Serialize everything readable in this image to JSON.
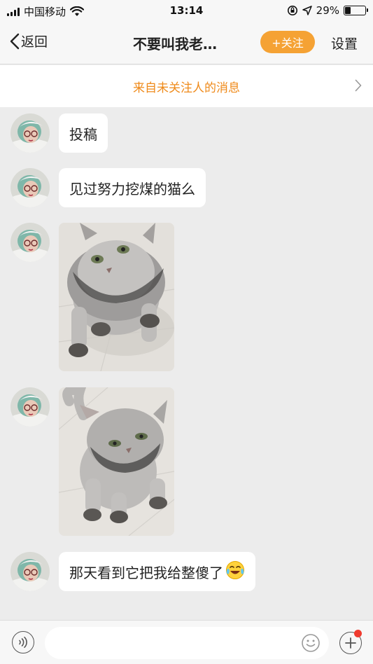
{
  "status_bar": {
    "carrier": "中国移动",
    "time": "13:14",
    "battery_percent": "29%",
    "battery_level": 0.29,
    "icons": [
      "signal-icon",
      "wifi-icon",
      "orientation-lock-icon",
      "location-icon",
      "battery-icon"
    ]
  },
  "nav": {
    "back_label": "返回",
    "title": "不要叫我老…",
    "follow_label": "+关注",
    "settings_label": "设置"
  },
  "banner": {
    "text": "来自未关注人的消息"
  },
  "messages": [
    {
      "type": "text",
      "text": "投稿"
    },
    {
      "type": "text",
      "text": "见过努力挖煤的猫么"
    },
    {
      "type": "image",
      "icon": "gray-cat-photo-1"
    },
    {
      "type": "image",
      "icon": "gray-cat-photo-2"
    },
    {
      "type": "text",
      "text": "那天看到它把我给整傻了",
      "emoji": "😂"
    }
  ],
  "input_bar": {
    "placeholder": "",
    "icons": [
      "voice-icon",
      "emoji-icon",
      "plus-icon"
    ]
  },
  "colors": {
    "accent_orange": "#f5a234",
    "banner_text": "#ef8a1a",
    "background": "#ececec",
    "notification_dot": "#f03b2f"
  }
}
